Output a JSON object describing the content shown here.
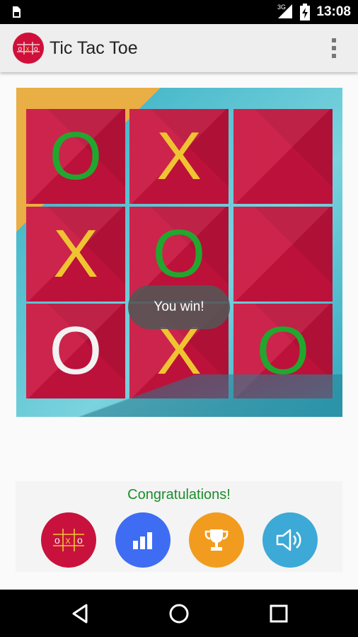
{
  "status_bar": {
    "network": "3G",
    "time": "13:08",
    "icons": [
      "sim-card-icon",
      "signal-icon",
      "battery-charging-icon"
    ]
  },
  "app_bar": {
    "title": "Tic Tac Toe",
    "logo_icon": "oxo-logo-icon",
    "menu_icon": "overflow-menu-icon"
  },
  "board": {
    "cells": [
      "O",
      "X",
      "",
      "X",
      "O",
      "",
      "O",
      "X",
      "O"
    ],
    "colors": {
      "O": "#22a72e",
      "X": "#f0c431",
      "O_last": "#f2f2f2",
      "cell": "#c8123d"
    },
    "toast": "You win!"
  },
  "footer": {
    "message": "Congratulations!",
    "buttons": [
      {
        "icon": "oxo-new-game-icon",
        "color": "#c8123d"
      },
      {
        "icon": "stats-icon",
        "color": "#3e6df3"
      },
      {
        "icon": "trophy-icon",
        "color": "#f29c1f"
      },
      {
        "icon": "sound-icon",
        "color": "#3ca9d6"
      }
    ]
  },
  "navigation": {
    "back_icon": "back-icon",
    "home_icon": "home-icon",
    "recents_icon": "recents-icon"
  }
}
